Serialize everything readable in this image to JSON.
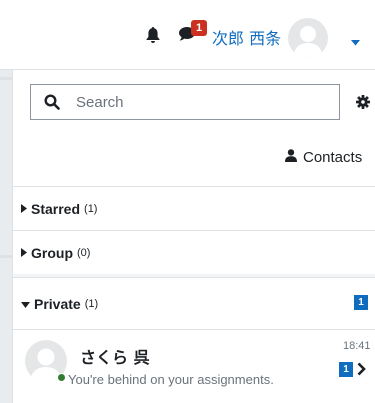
{
  "navbar": {
    "user_name": "次郎 西条",
    "message_count": "1",
    "icons": [
      "bell-icon",
      "chat-icon",
      "avatar",
      "caret-down-icon"
    ]
  },
  "drawer": {
    "search": {
      "placeholder": "Search",
      "value": ""
    },
    "contacts_label": "Contacts",
    "sections": {
      "starred": {
        "label": "Starred",
        "count": "(1)"
      },
      "group": {
        "label": "Group",
        "count": "(0)"
      },
      "private": {
        "label": "Private",
        "count": "(1)",
        "unread": "1"
      }
    },
    "conversation": {
      "name": "さくら 呉",
      "last_message": "You're behind on your assignments.",
      "time": "18:41",
      "unread": "1"
    }
  },
  "colors": {
    "brand": "#0f6cbf",
    "alert": "#ca3120",
    "online": "#357a32"
  }
}
